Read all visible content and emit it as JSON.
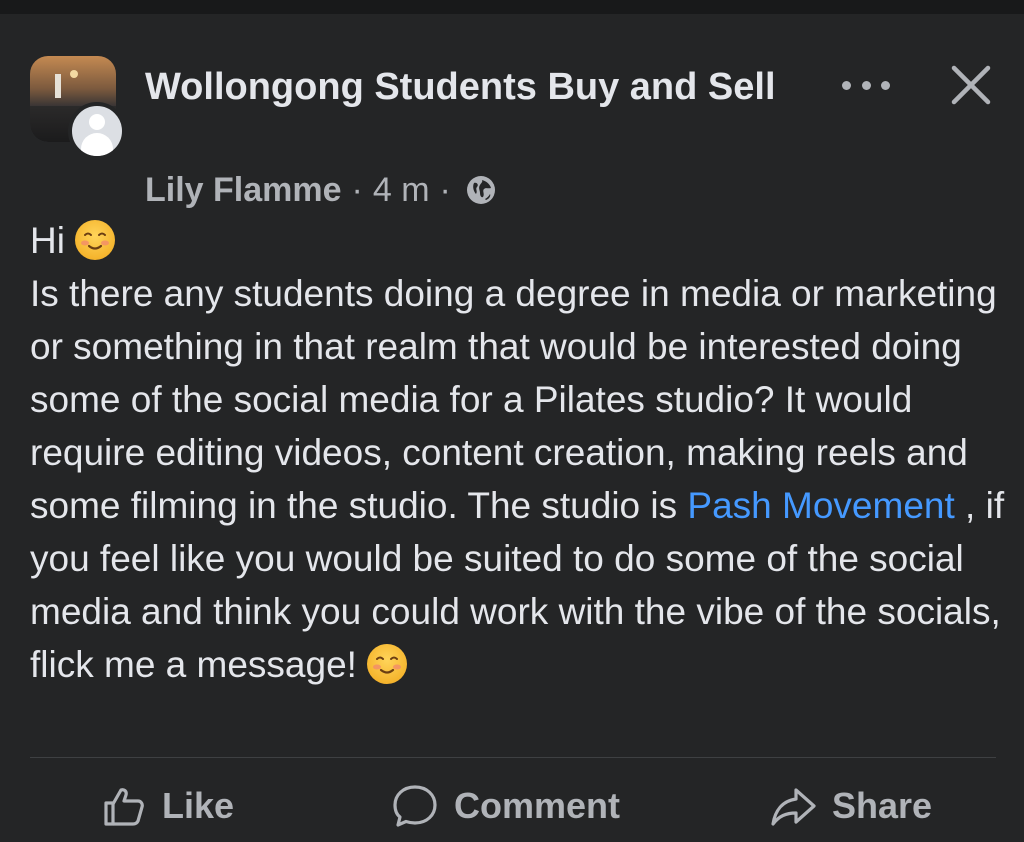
{
  "post": {
    "group_name": "Wollongong Students Buy and Sell",
    "author": "Lily Flamme",
    "time": "4 m",
    "separator": "·",
    "audience_icon": "globe-icon",
    "greeting": "Hi",
    "body_before_link": "Is there any students doing a degree in media or marketing or something in that realm that would be interested doing some of the social media for a Pilates studio? It would require editing videos, content creation, making reels and some filming in the studio. The studio is",
    "link_text": "Pash Movement",
    "body_after_link": " , if you feel like you would be suited to do some of the social media and think you could work with the vibe of the socials, flick me a message!",
    "emoji": "smiling-face-icon"
  },
  "header_actions": {
    "more_icon": "more-options-icon",
    "close_icon": "close-icon"
  },
  "actions": [
    {
      "label": "Like",
      "icon": "thumbs-up-icon"
    },
    {
      "label": "Comment",
      "icon": "comment-bubble-icon"
    },
    {
      "label": "Share",
      "icon": "share-arrow-icon"
    }
  ],
  "colors": {
    "background": "#242526",
    "text": "#e4e6eb",
    "secondary_text": "#b0b3b8",
    "link": "#4599ff"
  }
}
